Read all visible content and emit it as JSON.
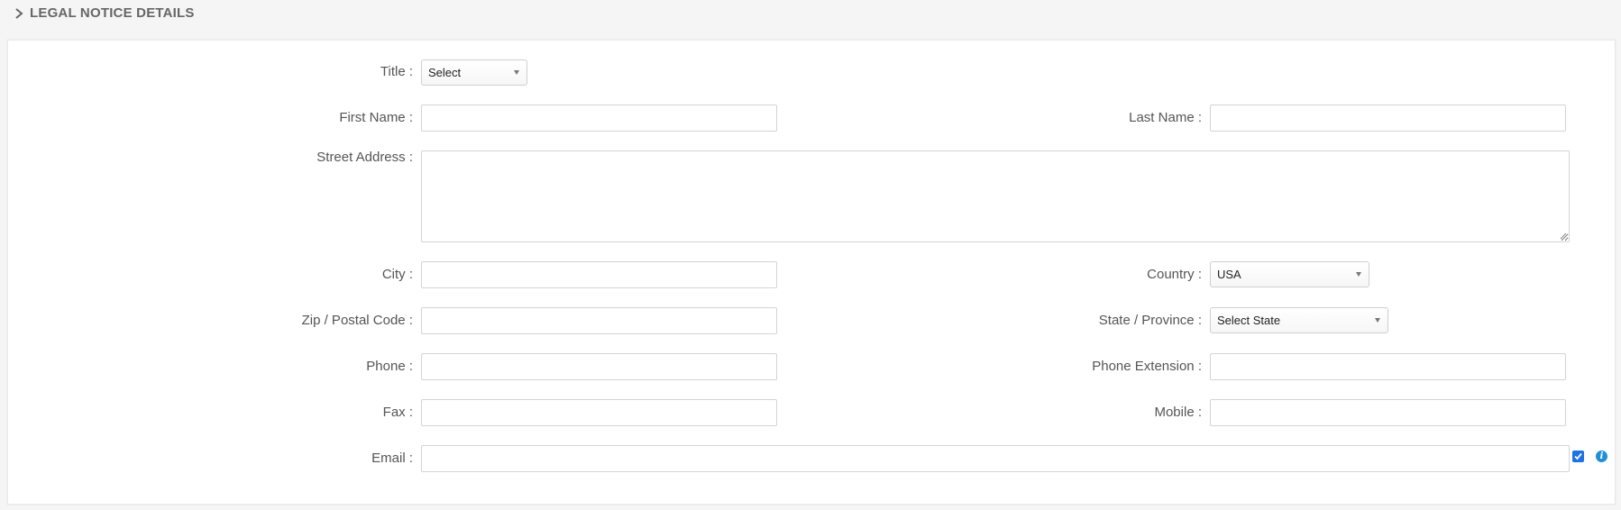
{
  "section": {
    "title": "LEGAL NOTICE DETAILS"
  },
  "form": {
    "title_label": "Title :",
    "title_value": "Select",
    "first_name_label": "First Name :",
    "first_name_value": "",
    "last_name_label": "Last Name :",
    "last_name_value": "",
    "street_address_label": "Street Address :",
    "street_address_value": "",
    "city_label": "City :",
    "city_value": "",
    "country_label": "Country :",
    "country_value": "USA",
    "zip_label": "Zip / Postal Code :",
    "zip_value": "",
    "state_label": "State / Province :",
    "state_value": "Select State",
    "phone_label": "Phone :",
    "phone_value": "",
    "phone_ext_label": "Phone Extension :",
    "phone_ext_value": "",
    "fax_label": "Fax :",
    "fax_value": "",
    "mobile_label": "Mobile :",
    "mobile_value": "",
    "email_label": "Email :",
    "email_value": "",
    "email_checkbox_checked": true
  },
  "icons": {
    "section_toggle": "chevron-right-icon",
    "email_info": "info-icon",
    "info_glyph": "i"
  },
  "colors": {
    "accent": "#1a73e8",
    "info": "#1e90d6",
    "label": "#555555"
  }
}
